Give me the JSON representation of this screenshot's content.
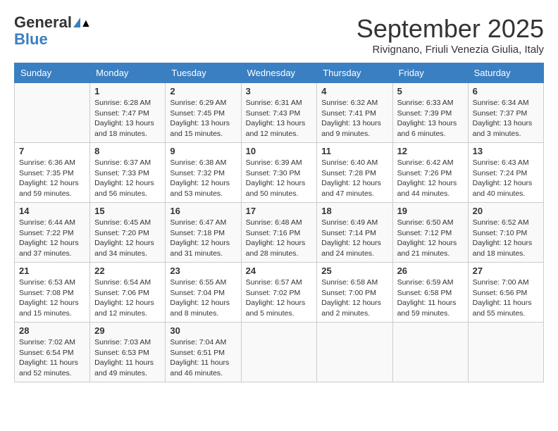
{
  "header": {
    "logo_general": "General",
    "logo_blue": "Blue",
    "month_title": "September 2025",
    "location": "Rivignano, Friuli Venezia Giulia, Italy"
  },
  "days_of_week": [
    "Sunday",
    "Monday",
    "Tuesday",
    "Wednesday",
    "Thursday",
    "Friday",
    "Saturday"
  ],
  "weeks": [
    [
      {
        "day": "",
        "info": ""
      },
      {
        "day": "1",
        "info": "Sunrise: 6:28 AM\nSunset: 7:47 PM\nDaylight: 13 hours\nand 18 minutes."
      },
      {
        "day": "2",
        "info": "Sunrise: 6:29 AM\nSunset: 7:45 PM\nDaylight: 13 hours\nand 15 minutes."
      },
      {
        "day": "3",
        "info": "Sunrise: 6:31 AM\nSunset: 7:43 PM\nDaylight: 13 hours\nand 12 minutes."
      },
      {
        "day": "4",
        "info": "Sunrise: 6:32 AM\nSunset: 7:41 PM\nDaylight: 13 hours\nand 9 minutes."
      },
      {
        "day": "5",
        "info": "Sunrise: 6:33 AM\nSunset: 7:39 PM\nDaylight: 13 hours\nand 6 minutes."
      },
      {
        "day": "6",
        "info": "Sunrise: 6:34 AM\nSunset: 7:37 PM\nDaylight: 13 hours\nand 3 minutes."
      }
    ],
    [
      {
        "day": "7",
        "info": "Sunrise: 6:36 AM\nSunset: 7:35 PM\nDaylight: 12 hours\nand 59 minutes."
      },
      {
        "day": "8",
        "info": "Sunrise: 6:37 AM\nSunset: 7:33 PM\nDaylight: 12 hours\nand 56 minutes."
      },
      {
        "day": "9",
        "info": "Sunrise: 6:38 AM\nSunset: 7:32 PM\nDaylight: 12 hours\nand 53 minutes."
      },
      {
        "day": "10",
        "info": "Sunrise: 6:39 AM\nSunset: 7:30 PM\nDaylight: 12 hours\nand 50 minutes."
      },
      {
        "day": "11",
        "info": "Sunrise: 6:40 AM\nSunset: 7:28 PM\nDaylight: 12 hours\nand 47 minutes."
      },
      {
        "day": "12",
        "info": "Sunrise: 6:42 AM\nSunset: 7:26 PM\nDaylight: 12 hours\nand 44 minutes."
      },
      {
        "day": "13",
        "info": "Sunrise: 6:43 AM\nSunset: 7:24 PM\nDaylight: 12 hours\nand 40 minutes."
      }
    ],
    [
      {
        "day": "14",
        "info": "Sunrise: 6:44 AM\nSunset: 7:22 PM\nDaylight: 12 hours\nand 37 minutes."
      },
      {
        "day": "15",
        "info": "Sunrise: 6:45 AM\nSunset: 7:20 PM\nDaylight: 12 hours\nand 34 minutes."
      },
      {
        "day": "16",
        "info": "Sunrise: 6:47 AM\nSunset: 7:18 PM\nDaylight: 12 hours\nand 31 minutes."
      },
      {
        "day": "17",
        "info": "Sunrise: 6:48 AM\nSunset: 7:16 PM\nDaylight: 12 hours\nand 28 minutes."
      },
      {
        "day": "18",
        "info": "Sunrise: 6:49 AM\nSunset: 7:14 PM\nDaylight: 12 hours\nand 24 minutes."
      },
      {
        "day": "19",
        "info": "Sunrise: 6:50 AM\nSunset: 7:12 PM\nDaylight: 12 hours\nand 21 minutes."
      },
      {
        "day": "20",
        "info": "Sunrise: 6:52 AM\nSunset: 7:10 PM\nDaylight: 12 hours\nand 18 minutes."
      }
    ],
    [
      {
        "day": "21",
        "info": "Sunrise: 6:53 AM\nSunset: 7:08 PM\nDaylight: 12 hours\nand 15 minutes."
      },
      {
        "day": "22",
        "info": "Sunrise: 6:54 AM\nSunset: 7:06 PM\nDaylight: 12 hours\nand 12 minutes."
      },
      {
        "day": "23",
        "info": "Sunrise: 6:55 AM\nSunset: 7:04 PM\nDaylight: 12 hours\nand 8 minutes."
      },
      {
        "day": "24",
        "info": "Sunrise: 6:57 AM\nSunset: 7:02 PM\nDaylight: 12 hours\nand 5 minutes."
      },
      {
        "day": "25",
        "info": "Sunrise: 6:58 AM\nSunset: 7:00 PM\nDaylight: 12 hours\nand 2 minutes."
      },
      {
        "day": "26",
        "info": "Sunrise: 6:59 AM\nSunset: 6:58 PM\nDaylight: 11 hours\nand 59 minutes."
      },
      {
        "day": "27",
        "info": "Sunrise: 7:00 AM\nSunset: 6:56 PM\nDaylight: 11 hours\nand 55 minutes."
      }
    ],
    [
      {
        "day": "28",
        "info": "Sunrise: 7:02 AM\nSunset: 6:54 PM\nDaylight: 11 hours\nand 52 minutes."
      },
      {
        "day": "29",
        "info": "Sunrise: 7:03 AM\nSunset: 6:53 PM\nDaylight: 11 hours\nand 49 minutes."
      },
      {
        "day": "30",
        "info": "Sunrise: 7:04 AM\nSunset: 6:51 PM\nDaylight: 11 hours\nand 46 minutes."
      },
      {
        "day": "",
        "info": ""
      },
      {
        "day": "",
        "info": ""
      },
      {
        "day": "",
        "info": ""
      },
      {
        "day": "",
        "info": ""
      }
    ]
  ]
}
